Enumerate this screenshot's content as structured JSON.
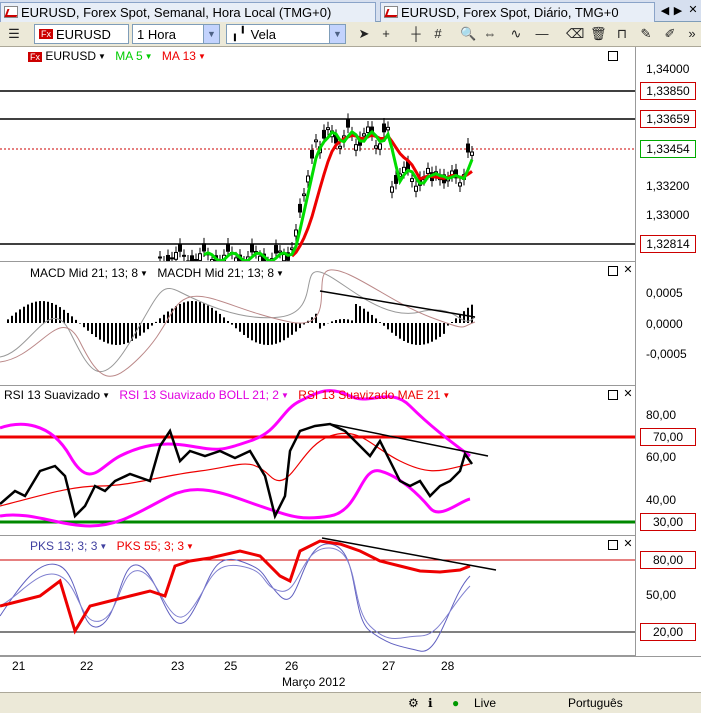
{
  "tabs": [
    {
      "label": "EURUSD, Forex Spot, Semanal, Hora Local (TMG+0)"
    },
    {
      "label": "EURUSD, Forex Spot, Diário, TMG+0"
    }
  ],
  "toolbar": {
    "symbol": "EURUSD",
    "timeframe": "1 Hora",
    "chart_style": "Vela"
  },
  "price_pane": {
    "symbol_label": "EURUSD",
    "indicators": [
      "MA 5",
      "MA 13"
    ],
    "ticks": [
      "1,34000",
      "1,33200",
      "1,33000"
    ],
    "tags": [
      "1,33850",
      "1,33659",
      "1,33454",
      "1,32814"
    ]
  },
  "macd_pane": {
    "labels": [
      "MACD Mid 21; 13; 8",
      "MACDH Mid 21; 13; 8"
    ],
    "ticks": [
      "0,0005",
      "0,0000",
      "-0,0005"
    ]
  },
  "rsi_pane": {
    "labels": [
      "RSI 13 Suavizado",
      "RSI 13 Suavizado BOLL 21; 2",
      "RSI 13 Suavizado MAE 21"
    ],
    "ticks": [
      "80,00",
      "60,00",
      "40,00"
    ],
    "tags": [
      "70,00",
      "30,00"
    ]
  },
  "pks_pane": {
    "labels": [
      "PKS 13; 3; 3",
      "PKS 55; 3; 3"
    ],
    "ticks": [
      "50,00"
    ],
    "tags": [
      "80,00",
      "20,00"
    ]
  },
  "xaxis": {
    "days": [
      "21",
      "22",
      "23",
      "25",
      "26",
      "27",
      "28"
    ],
    "month": "Março 2012"
  },
  "status": {
    "live": "Live",
    "language": "Português"
  },
  "colors": {
    "ma5": "#00dd00",
    "ma13": "#ee0000",
    "boll": "#ff00ff",
    "level_red": "#ee0000",
    "level_green": "#008800"
  }
}
